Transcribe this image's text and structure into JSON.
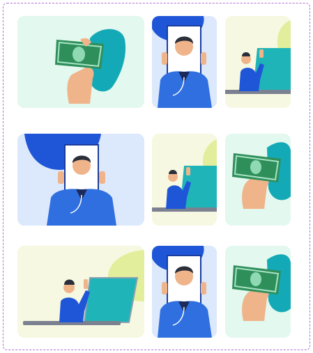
{
  "colors": {
    "frame_border": "#b06fd6",
    "mint_bg": "#e3f8ee",
    "blue_bg": "#dce8fb",
    "cream_bg": "#f7f8e1",
    "brand_blue": "#1f56d8",
    "teal": "#1fb5b8",
    "money_green": "#2f8f5b",
    "skin": "#f0b48a"
  },
  "gallery": {
    "cards": [
      {
        "illustration": "money-hand-illustration"
      },
      {
        "illustration": "video-call-person-illustration"
      },
      {
        "illustration": "laptop-woman-illustration"
      },
      {
        "illustration": "video-call-person-illustration"
      },
      {
        "illustration": "laptop-woman-illustration"
      },
      {
        "illustration": "money-hand-illustration"
      },
      {
        "illustration": "laptop-woman-illustration"
      },
      {
        "illustration": "video-call-person-illustration"
      },
      {
        "illustration": "money-hand-illustration"
      }
    ]
  }
}
